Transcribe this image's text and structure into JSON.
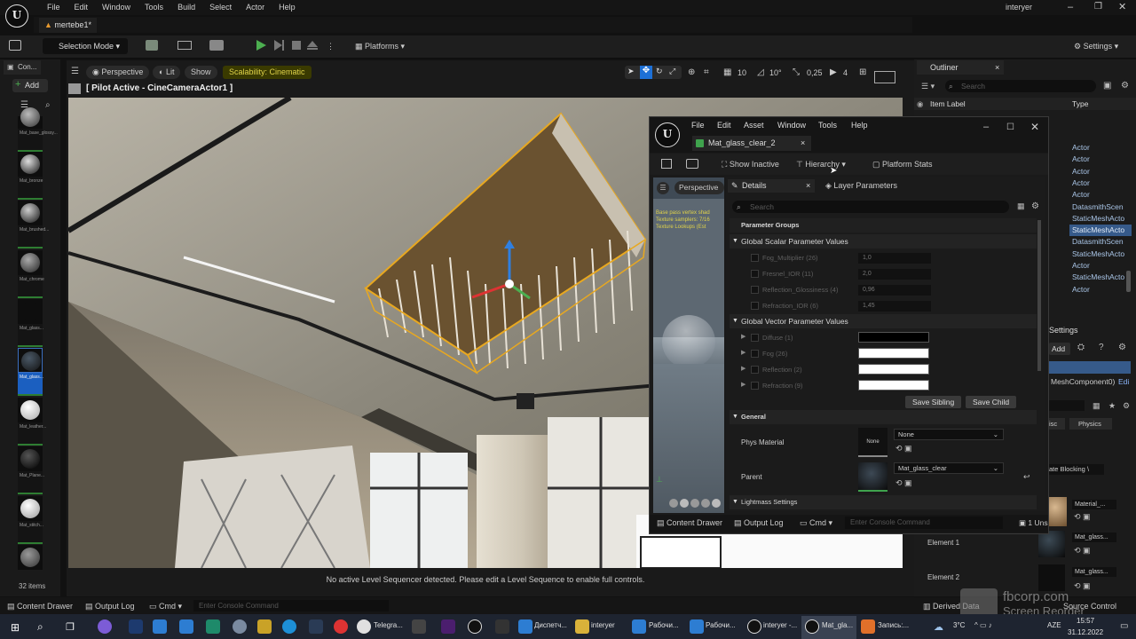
{
  "app": {
    "menus": [
      "File",
      "Edit",
      "Window",
      "Tools",
      "Build",
      "Select",
      "Actor",
      "Help"
    ],
    "project": "interyer"
  },
  "level_tab": "mertebe1*",
  "toolbar": {
    "selection_mode": "Selection Mode",
    "platforms": "Platforms",
    "settings": "Settings"
  },
  "content_drawer": {
    "tab": "Con...",
    "add": "Add",
    "items": [
      "Mat_base_glossy...",
      "Mat_bronze",
      "Mat_brushed...",
      "Mat_chrome",
      "Mat_glass...",
      "Mat_glass...",
      "Mat_leather...",
      "Mat_Plane...",
      "Mat_stitch..."
    ],
    "count": "32 items"
  },
  "viewport": {
    "perspective": "Perspective",
    "lit": "Lit",
    "show": "Show",
    "scalability": "Scalability: Cinematic",
    "pilot": "[ Pilot Active - CineCameraActor1 ]",
    "grid": "10",
    "angle": "10°",
    "scale": "0,25",
    "cam_speed": "4",
    "sequencer_msg": "No active Level Sequencer detected. Please edit a Level Sequence to enable full controls."
  },
  "outliner": {
    "title": "Outliner",
    "search": "Search",
    "col_label": "Item Label",
    "col_type": "Type",
    "types": [
      "Actor",
      "Actor",
      "Actor",
      "Actor",
      "Actor",
      "DatasmithScen",
      "StaticMeshActo",
      "StaticMeshActo",
      "DatasmithScen",
      "StaticMeshActo",
      "Actor",
      "StaticMeshActo",
      "Actor"
    ],
    "selected_index": 7
  },
  "right_details": {
    "settings": "Settings",
    "add": "Add",
    "component": "MeshComponent0)",
    "edit": "Edi",
    "physics": "Physics",
    "misc": "isc",
    "blocking": "ate Blocking \\",
    "element1": "Element 1",
    "element2": "Element 2",
    "mats": [
      "Material_...",
      "Mat_glass...",
      "Mat_glass..."
    ]
  },
  "material_window": {
    "menus": [
      "File",
      "Edit",
      "Asset",
      "Window",
      "Tools",
      "Help"
    ],
    "tab": "Mat_glass_clear_2",
    "show_inactive": "Show Inactive",
    "hierarchy": "Hierarchy",
    "platform_stats": "Platform Stats",
    "preview_tab": "Perspective",
    "preview_stats": [
      "Base pass vertex shad",
      "Texture samplers: 7/16",
      "Texture Lookups (Est"
    ],
    "details_tab": "Details",
    "layer_tab": "Layer Parameters",
    "search": "Search",
    "param_groups": "Parameter Groups",
    "scalar_header": "Global Scalar Parameter Values",
    "scalars": [
      {
        "name": "Fog_Multiplier (26)",
        "value": "1,0"
      },
      {
        "name": "Fresnel_IOR (11)",
        "value": "2,0"
      },
      {
        "name": "Reflection_Glossiness (4)",
        "value": "0,96"
      },
      {
        "name": "Refraction_IOR (6)",
        "value": "1,45"
      }
    ],
    "vector_header": "Global Vector Parameter Values",
    "vectors": [
      {
        "name": "Diffuse (1)",
        "color": "#000000"
      },
      {
        "name": "Fog (26)",
        "color": "#ffffff"
      },
      {
        "name": "Reflection (2)",
        "color": "#ffffff"
      },
      {
        "name": "Refraction (9)",
        "color": "#ffffff"
      }
    ],
    "save_sibling": "Save Sibling",
    "save_child": "Save Child",
    "general": "General",
    "phys_material": "Phys Material",
    "phys_thumb": "None",
    "phys_value": "None",
    "parent": "Parent",
    "parent_value": "Mat_glass_clear",
    "lightmass": "Lightmass Settings",
    "content_drawer": "Content Drawer",
    "output_log": "Output Log",
    "cmd": "Cmd",
    "console": "Enter Console Command",
    "unsaved": "1 Uns"
  },
  "bottom": {
    "content_drawer": "Content Drawer",
    "output_log": "Output Log",
    "cmd": "Cmd",
    "console": "Enter Console Command",
    "derived": "Derived Data",
    "source": "Source Control"
  },
  "watermark": {
    "line1": "fbcorp.com",
    "line2": "Screen Reorder"
  },
  "taskbar": {
    "apps": [
      "Telegra...",
      "Диспетч...",
      "interyer",
      "Рабочи...",
      "Рабочи...",
      "interyer -...",
      "Mat_gla...",
      "Запись:..."
    ],
    "temp": "3°C",
    "lang": "AZE",
    "time": "15:57",
    "date": "31.12.2022"
  }
}
